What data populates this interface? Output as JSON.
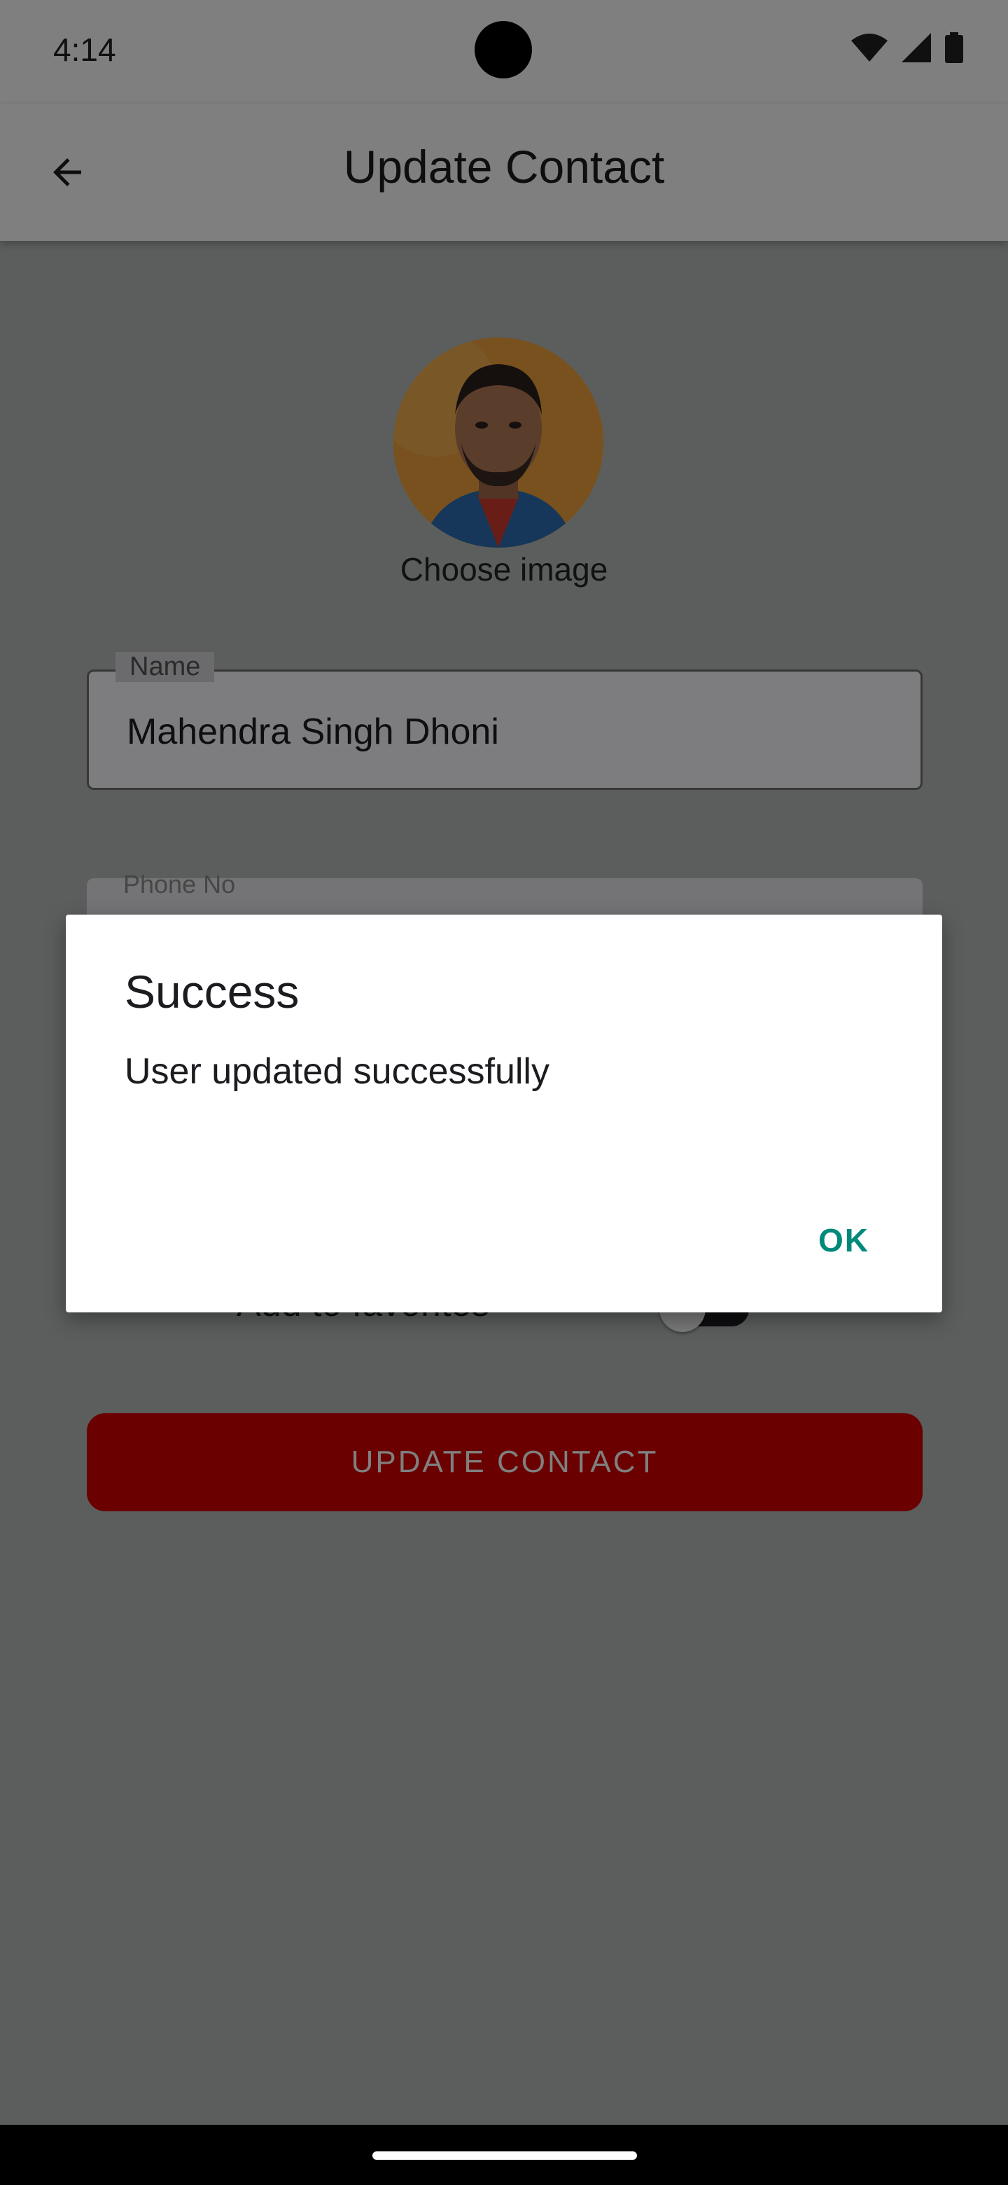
{
  "status_bar": {
    "time": "4:14",
    "icons": [
      "wifi-icon",
      "cellular-signal-icon",
      "battery-icon"
    ]
  },
  "app_bar": {
    "back_icon": "arrow-back-icon",
    "title": "Update Contact"
  },
  "form": {
    "choose_image_label": "Choose image",
    "name_label": "Name",
    "name_value": "Mahendra Singh Dhoni",
    "phone_label": "Phone No",
    "favorite_label": "Add to favorites",
    "favorite_enabled": false,
    "update_button_label": "UPDATE  CONTACT"
  },
  "dialog": {
    "title": "Success",
    "message": "User updated successfully",
    "ok_label": "OK"
  },
  "colors": {
    "accent_teal": "#00897b",
    "primary_red": "#d50000",
    "scrim": "rgba(0,0,0,0.5)"
  }
}
